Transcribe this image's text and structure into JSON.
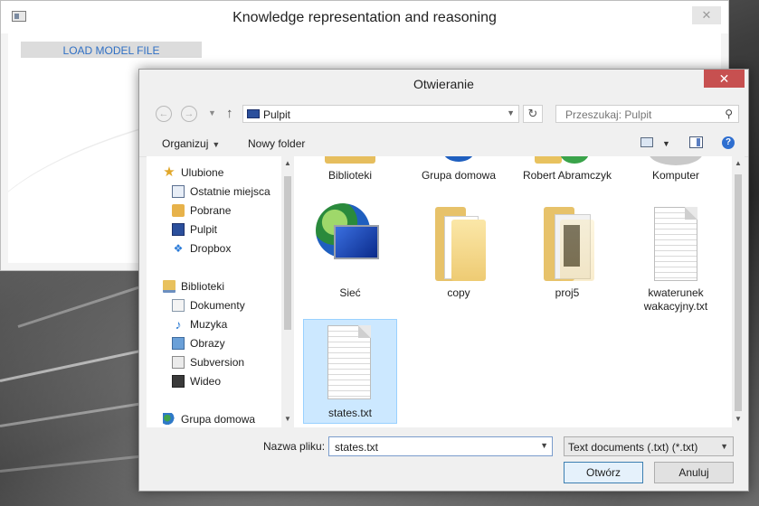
{
  "app": {
    "title": "Knowledge representation and reasoning",
    "close": "✕",
    "load_button": "LOAD MODEL FILE"
  },
  "dialog": {
    "title": "Otwieranie",
    "close": "✕",
    "nav": {
      "back": "←",
      "forward": "→",
      "up": "↑",
      "address": "Pulpit",
      "refresh": "↻",
      "search_placeholder": "Przeszukaj: Pulpit"
    },
    "toolbar": {
      "organize": "Organizuj",
      "new_folder": "Nowy folder",
      "help": "?"
    },
    "nav_pane": {
      "favorites": "Ulubione",
      "recent": "Ostatnie miejsca",
      "downloads": "Pobrane",
      "desktop": "Pulpit",
      "dropbox": "Dropbox",
      "libraries": "Biblioteki",
      "documents": "Dokumenty",
      "music": "Muzyka",
      "pictures": "Obrazy",
      "subversion": "Subversion",
      "videos": "Wideo",
      "homegroup": "Grupa domowa"
    },
    "files": {
      "biblioteki": "Biblioteki",
      "grupa": "Grupa domowa",
      "robert": "Robert Abramczyk",
      "komputer": "Komputer",
      "siec": "Sieć",
      "copy": "copy",
      "proj5": "proj5",
      "kwaterunek": "kwaterunek wakacyjny.txt",
      "states": "states.txt"
    },
    "filename_label": "Nazwa pliku:",
    "filename_value": "states.txt",
    "filter": "Text documents (.txt) (*.txt)",
    "open_button": "Otwórz",
    "cancel_button": "Anuluj"
  }
}
